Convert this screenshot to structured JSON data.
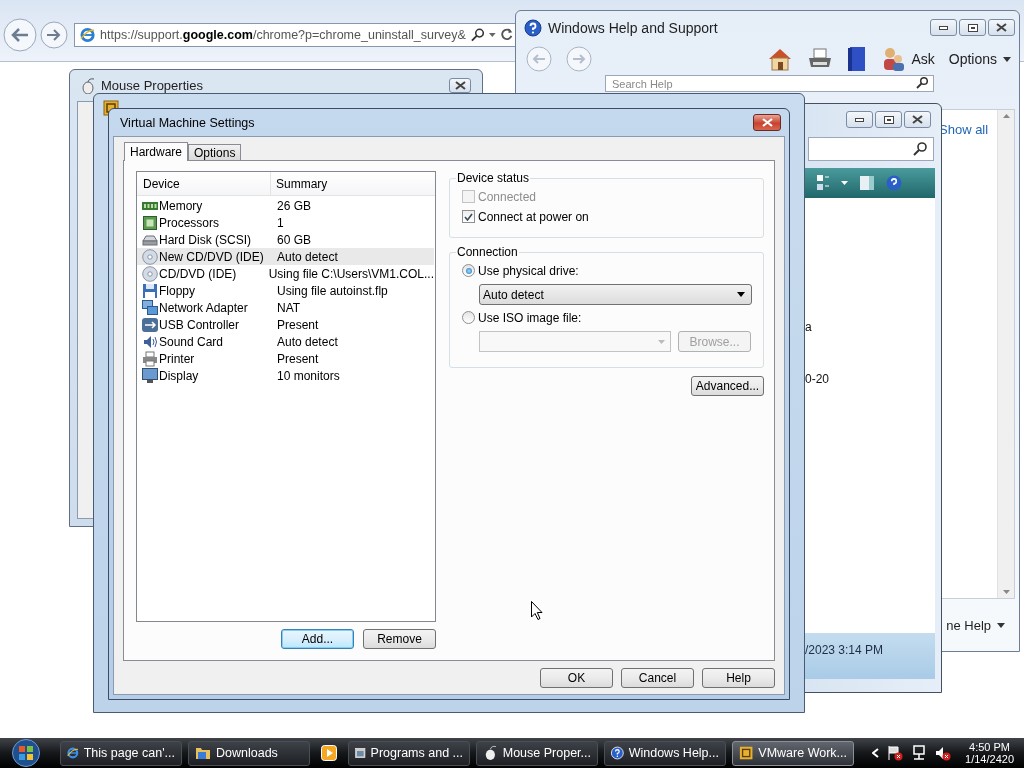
{
  "browser": {
    "address": "https://support.**google.com**/chrome?p=chrome_uninstall_survey&"
  },
  "help_window": {
    "title": "Windows Help and Support",
    "toolbar": [
      {
        "kind": "home"
      },
      {
        "kind": "print"
      },
      {
        "kind": "browse"
      },
      {
        "kind": "ask",
        "label": "Ask"
      },
      {
        "kind": "options",
        "label": "Options"
      }
    ],
    "search": {
      "placeholder": "Search Help"
    },
    "link": "Show all",
    "footer": "ne Help"
  },
  "explorer_window": {
    "lines": [
      "a",
      "0-20"
    ],
    "status": "/2023 3:14 PM"
  },
  "mouse_window": {
    "title": "Mouse Properties"
  },
  "dialog": {
    "title": "Virtual Machine Settings",
    "tabs": [
      {
        "label": "Hardware",
        "selected": true
      },
      {
        "label": "Options",
        "selected": false
      }
    ],
    "columns": [
      "Device",
      "Summary"
    ],
    "devices": [
      {
        "kind": "memory",
        "name": "Memory",
        "summary": "26 GB",
        "selected": false
      },
      {
        "kind": "processor",
        "name": "Processors",
        "summary": "1",
        "selected": false
      },
      {
        "kind": "disk",
        "name": "Hard Disk (SCSI)",
        "summary": "60 GB",
        "selected": false
      },
      {
        "kind": "cdrom",
        "name": "New CD/DVD (IDE)",
        "summary": "Auto detect",
        "selected": true
      },
      {
        "kind": "cdrom",
        "name": "CD/DVD (IDE)",
        "summary": "Using file C:\\Users\\VM1.COL...",
        "selected": false
      },
      {
        "kind": "floppy",
        "name": "Floppy",
        "summary": "Using file autoinst.flp",
        "selected": false
      },
      {
        "kind": "network",
        "name": "Network Adapter",
        "summary": "NAT",
        "selected": false
      },
      {
        "kind": "usb",
        "name": "USB Controller",
        "summary": "Present",
        "selected": false
      },
      {
        "kind": "sound",
        "name": "Sound Card",
        "summary": "Auto detect",
        "selected": false
      },
      {
        "kind": "printer",
        "name": "Printer",
        "summary": "Present",
        "selected": false
      },
      {
        "kind": "display",
        "name": "Display",
        "summary": "10 monitors",
        "selected": false
      }
    ],
    "list_buttons": [
      {
        "label": "Add...",
        "focused": true
      },
      {
        "label": "Remove",
        "focused": false
      }
    ],
    "device_status": {
      "title": "Device status",
      "options": [
        {
          "label": "Connected",
          "checked": false,
          "disabled": true
        },
        {
          "label": "Connect at power on",
          "checked": true,
          "disabled": false
        }
      ]
    },
    "connection": {
      "title": "Connection",
      "options": [
        {
          "label": "Use physical drive:",
          "selected": true
        },
        {
          "label": "Use ISO image file:",
          "selected": false
        }
      ],
      "drive": "Auto detect",
      "iso_file": {
        "disabled": true
      },
      "browse": {
        "label": "Browse...",
        "disabled": true
      }
    },
    "advanced": "Advanced...",
    "buttons": [
      "OK",
      "Cancel",
      "Help"
    ]
  },
  "taskbar": {
    "items": [
      {
        "kind": "browser",
        "label": "This page can'...",
        "selected": false
      },
      {
        "kind": "folder",
        "label": "Downloads",
        "selected": false
      },
      {
        "kind": "media",
        "selected": false
      },
      {
        "kind": "programs",
        "label": "Programs and ...",
        "selected": false
      },
      {
        "kind": "mouse",
        "label": "Mouse Proper...",
        "selected": false
      },
      {
        "kind": "help",
        "label": "Windows Help...",
        "selected": false
      },
      {
        "kind": "vmware",
        "label": "VMware Work...",
        "selected": true
      }
    ],
    "time": "4:50 PM",
    "date": "1/14/2420"
  }
}
